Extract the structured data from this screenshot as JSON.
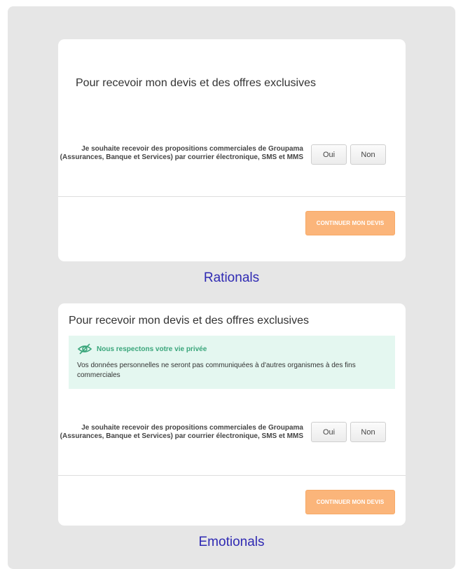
{
  "cards": {
    "rational": {
      "title": "Pour recevoir mon devis et des offres exclusives",
      "consent_line1": "Je souhaite recevoir des propositions commerciales de Groupama",
      "consent_line2": "(Assurances, Banque et Services) par courrier électronique, SMS et MMS",
      "yes_label": "Oui",
      "no_label": "Non",
      "continue_label": "CONTINUER MON DEVIS"
    },
    "emotional": {
      "title": "Pour recevoir mon devis et des offres exclusives",
      "privacy_title": "Nous respectons votre vie privée",
      "privacy_body": "Vos données personnelles ne seront pas communiquées à d'autres organismes à des fins commerciales",
      "consent_line1": "Je souhaite recevoir des propositions commerciales de Groupama",
      "consent_line2": "(Assurances, Banque et Services) par courrier électronique, SMS et MMS",
      "yes_label": "Oui",
      "no_label": "Non",
      "continue_label": "CONTINUER MON DEVIS"
    }
  },
  "captions": {
    "rational": "Rationals",
    "emotional": "Emotionals"
  },
  "icons": {
    "privacy": "eye-slash-icon"
  },
  "colors": {
    "accent_button": "#fbb57a",
    "privacy_background": "#e4f7f0",
    "privacy_title": "#3aa67b",
    "caption": "#2f2ab3",
    "panel_background": "#e6e6e6"
  }
}
